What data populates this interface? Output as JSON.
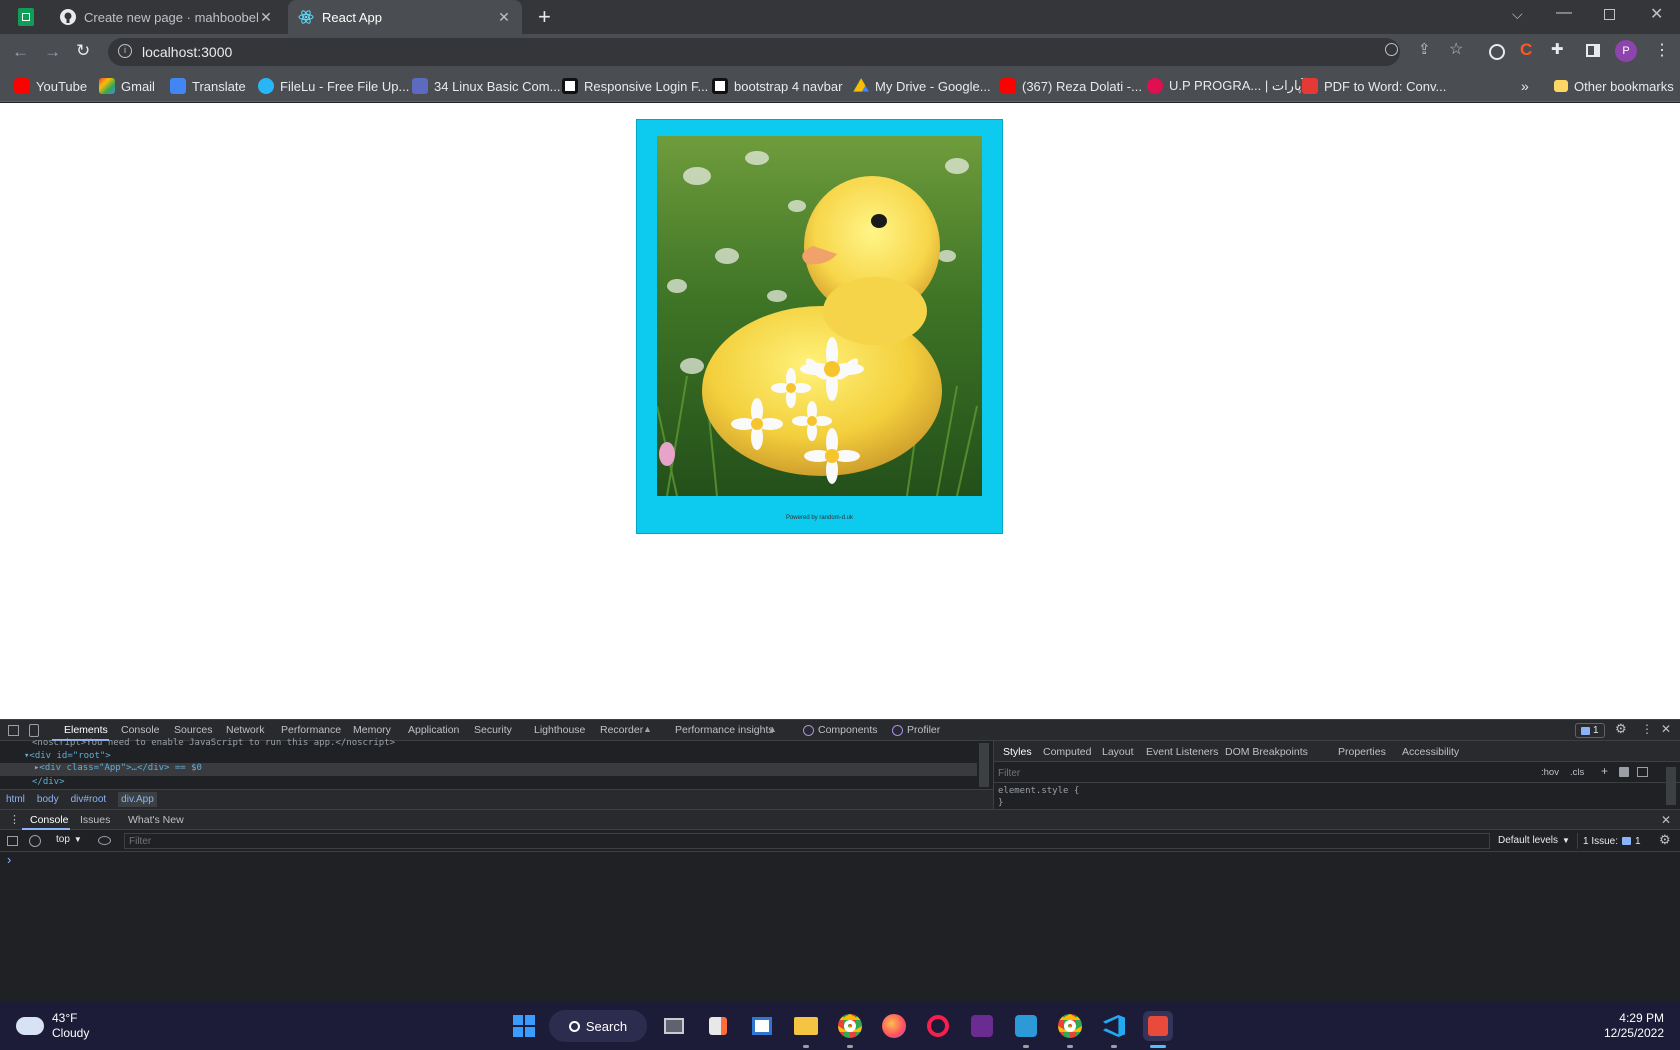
{
  "browser": {
    "tabs": [
      {
        "title": "Create new page · mahboobehjan",
        "active": false
      },
      {
        "title": "React App",
        "active": true
      }
    ],
    "address": "localhost:3000",
    "bookmarks": [
      {
        "label": "YouTube",
        "icon": "youtube-icon"
      },
      {
        "label": "Gmail",
        "icon": "gmail-icon"
      },
      {
        "label": "Translate",
        "icon": "translate-icon"
      },
      {
        "label": "FileLu - Free File Up...",
        "icon": "filelu-icon"
      },
      {
        "label": "34 Linux Basic Com...",
        "icon": "linux-icon"
      },
      {
        "label": "Responsive Login F...",
        "icon": "codepen-icon"
      },
      {
        "label": "bootstrap 4 navbar",
        "icon": "codepen-icon"
      },
      {
        "label": "My Drive - Google...",
        "icon": "drive-icon"
      },
      {
        "label": "(367) Reza Dolati -...",
        "icon": "youtube-icon"
      },
      {
        "label": "U.P PROGRA... | آپارات",
        "icon": "aparat-icon"
      },
      {
        "label": "PDF to Word: Conv...",
        "icon": "pdf-icon"
      }
    ],
    "other_bookmarks": "Other bookmarks",
    "profile_initial": "P"
  },
  "page": {
    "powered_by": "Powered by random-d.uk",
    "image_alt": "yellow duckling sitting among daisies"
  },
  "devtools": {
    "tabs": [
      "Elements",
      "Console",
      "Sources",
      "Network",
      "Performance",
      "Memory",
      "Application",
      "Security",
      "Lighthouse",
      "Recorder",
      "Performance insights",
      "Components",
      "Profiler"
    ],
    "active_tab": "Elements",
    "issues_badge": "1",
    "dom_lines": [
      "<noscript>You need to enable JavaScript to run this app.</noscript>",
      "<div id=\"root\">",
      "<div class=\"App\">…</div> == $0",
      "</div>"
    ],
    "breadcrumbs": [
      "html",
      "body",
      "div#root",
      "div.App"
    ],
    "style_tabs": [
      "Styles",
      "Computed",
      "Layout",
      "Event Listeners",
      "DOM Breakpoints",
      "Properties",
      "Accessibility"
    ],
    "style_filter_placeholder": "Filter",
    "hov": ":hov",
    "cls": ".cls",
    "element_style": "element.style {",
    "element_style_close": "}",
    "drawer_tabs": [
      "Console",
      "Issues",
      "What's New"
    ],
    "context": "top",
    "console_filter_placeholder": "Filter",
    "levels": "Default levels",
    "issues_count": "1 Issue:",
    "issues_count_badge": "1",
    "prompt": "›"
  },
  "taskbar": {
    "temperature": "43°F",
    "weather": "Cloudy",
    "search_label": "Search",
    "time": "4:29 PM",
    "date": "12/25/2022"
  },
  "colors": {
    "card_bg": "#0ccbee",
    "accent": "#8ab4f8"
  }
}
